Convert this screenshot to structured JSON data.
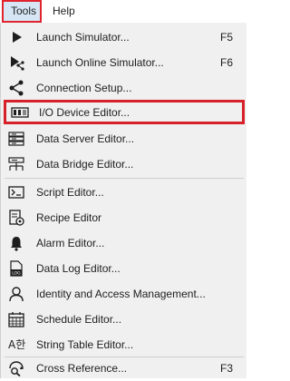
{
  "menubar": {
    "items": [
      {
        "label": "Tools"
      },
      {
        "label": "Help"
      }
    ]
  },
  "menu": {
    "items": [
      {
        "label": "Launch Simulator...",
        "shortcut": "F5",
        "icon": "play-icon"
      },
      {
        "label": "Launch Online Simulator...",
        "shortcut": "F6",
        "icon": "play-share-icon"
      },
      {
        "label": "Connection Setup...",
        "icon": "share-icon"
      },
      {
        "label": "I/O Device Editor...",
        "icon": "io-device-icon"
      },
      {
        "label": "Data Server Editor...",
        "icon": "data-server-icon"
      },
      {
        "label": "Data Bridge Editor...",
        "icon": "data-bridge-icon"
      },
      {
        "label": "Script Editor...",
        "icon": "script-icon"
      },
      {
        "label": "Recipe Editor",
        "icon": "recipe-icon"
      },
      {
        "label": "Alarm Editor...",
        "icon": "bell-icon"
      },
      {
        "label": "Data Log Editor...",
        "icon": "log-icon"
      },
      {
        "label": "Identity and Access Management...",
        "icon": "user-icon"
      },
      {
        "label": "Schedule Editor...",
        "icon": "calendar-icon"
      },
      {
        "label": "String Table Editor...",
        "icon": "string-table-icon",
        "icon_text": "A한"
      },
      {
        "label": "Cross Reference...",
        "shortcut": "F3",
        "icon": "cross-reference-icon"
      }
    ]
  },
  "colors": {
    "highlight_border": "#d6202a",
    "menu_background": "#f0f0f0",
    "tools_active_background": "#d7e6f5"
  }
}
